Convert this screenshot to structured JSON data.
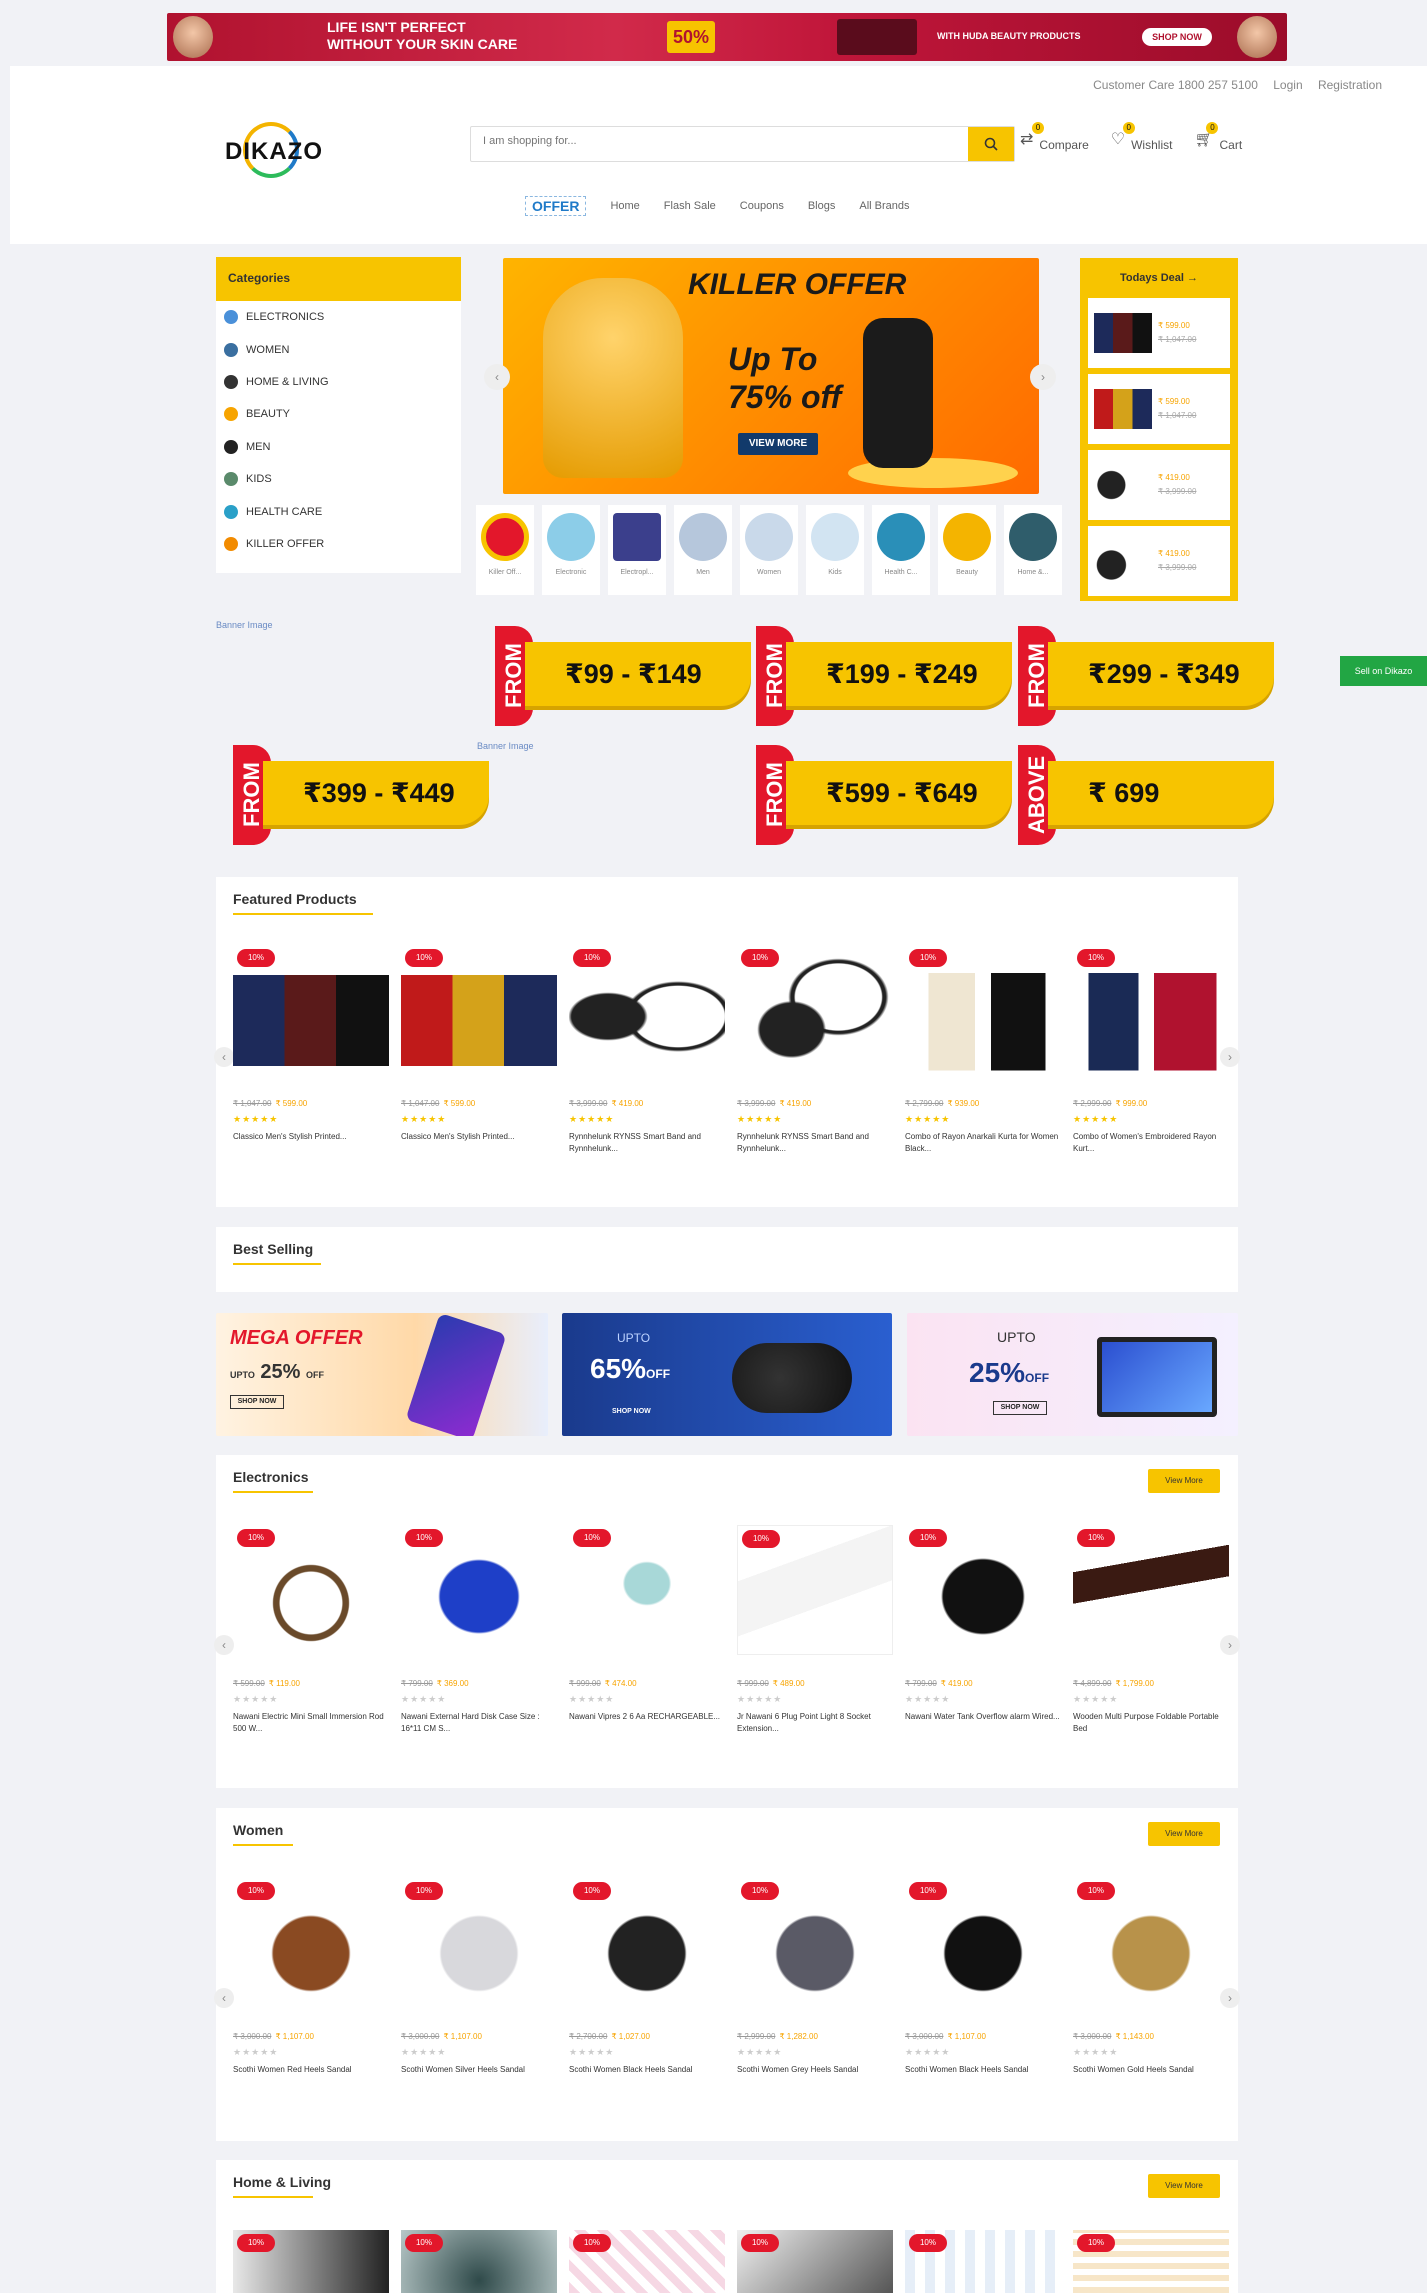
{
  "colors": {
    "accent": "#f7c400",
    "sale": "#e3172b",
    "green": "#22a644",
    "navy": "#123a6b"
  },
  "topbar": {
    "line1": "LIFE ISN'T PERFECT",
    "line2": "WITHOUT YOUR SKIN CARE",
    "badge": "50%",
    "promo": "WITH HUDA BEAUTY PRODUCTS",
    "shop": "SHOP NOW"
  },
  "util": {
    "care": "Customer Care 1800 257 5100",
    "login": "Login",
    "register": "Registration"
  },
  "logo": {
    "text": "DIKAZO"
  },
  "search": {
    "placeholder": "I am shopping for..."
  },
  "header_icons": {
    "compare": "Compare",
    "wishlist": "Wishlist",
    "cart": "Cart",
    "compare_count": "0",
    "wishlist_count": "0",
    "cart_count": "0"
  },
  "nav": {
    "offer": "OFFER",
    "items": [
      "Home",
      "Flash Sale",
      "Coupons",
      "Blogs",
      "All Brands"
    ]
  },
  "categories": {
    "title": "Categories",
    "items": [
      "ELECTRONICS",
      "WOMEN",
      "HOME & LIVING",
      "BEAUTY",
      "MEN",
      "KIDS",
      "HEALTH CARE",
      "KILLER OFFER"
    ]
  },
  "hero": {
    "title": "KILLER OFFER",
    "line1": "Up To",
    "line2": "75% off",
    "cta": "VIEW MORE"
  },
  "category_circles": [
    "Killer Off...",
    "Electronic",
    "Electropl...",
    "Men",
    "Women",
    "Kids",
    "Health C...",
    "Beauty",
    "Home &..."
  ],
  "todays_deal": {
    "title": "Todays Deal",
    "items": [
      {
        "price": "₹ 599.00",
        "old": "₹ 1,047.00"
      },
      {
        "price": "₹ 599.00",
        "old": "₹ 1,047.00"
      },
      {
        "price": "₹ 419.00",
        "old": "₹ 3,999.00"
      },
      {
        "price": "₹ 419.00",
        "old": "₹ 3,999.00"
      }
    ]
  },
  "price_tags": [
    {
      "label": "FROM",
      "range": "₹99 - ₹149"
    },
    {
      "label": "FROM",
      "range": "₹199 - ₹249"
    },
    {
      "label": "FROM",
      "range": "₹299 - ₹349"
    },
    {
      "label": "FROM",
      "range": "₹399 - ₹449"
    },
    {
      "label": "FROM",
      "range": "₹599 - ₹649"
    },
    {
      "label": "ABOVE",
      "range": "₹ 699"
    }
  ],
  "broken_images": [
    "Banner Image",
    "Banner Image"
  ],
  "green_button": "Sell on Dikazo",
  "featured": {
    "title": "Featured Products",
    "products": [
      {
        "old": "₹ 1,047.00",
        "price": "₹ 599.00",
        "name": "Classico Men's Stylish Printed..."
      },
      {
        "old": "₹ 1,047.00",
        "price": "₹ 599.00",
        "name": "Classico Men's Stylish Printed..."
      },
      {
        "old": "₹ 3,999.00",
        "price": "₹ 419.00",
        "name": "Rynnhelunk RYNSS Smart Band and Rynnhelunk..."
      },
      {
        "old": "₹ 3,999.00",
        "price": "₹ 419.00",
        "name": "Rynnhelunk RYNSS Smart Band and Rynnhelunk..."
      },
      {
        "old": "₹ 2,799.00",
        "price": "₹ 939.00",
        "name": "Combo of Rayon Anarkali Kurta for Women Black..."
      },
      {
        "old": "₹ 2,999.00",
        "price": "₹ 999.00",
        "name": "Combo of Women's Embroidered Rayon Kurt..."
      }
    ]
  },
  "best_selling": {
    "title": "Best Selling"
  },
  "banners": [
    {
      "title": "MEGA OFFER",
      "sub": "UPTO",
      "pct": "25%",
      "off": "OFF",
      "cta": "SHOP NOW"
    },
    {
      "sub": "UPTO",
      "pct": "65%",
      "off": "OFF",
      "cta": "SHOP NOW"
    },
    {
      "sub": "UPTO",
      "pct": "25%",
      "off": "OFF",
      "cta": "SHOP NOW"
    }
  ],
  "electronics": {
    "title": "Electronics",
    "more": "View More",
    "products": [
      {
        "old": "₹ 599.00",
        "price": "₹ 119.00",
        "name": "Nawani Electric Mini Small Immersion Rod 500 W..."
      },
      {
        "old": "₹ 799.00",
        "price": "₹ 369.00",
        "name": "Nawani External Hard Disk Case Size : 16*11 CM S..."
      },
      {
        "old": "₹ 999.00",
        "price": "₹ 474.00",
        "name": "Nawani Vipres 2 6 Aa RECHARGEABLE..."
      },
      {
        "old": "₹ 999.00",
        "price": "₹ 489.00",
        "name": "Jr Nawani 6 Plug Point Light 8 Socket Extension..."
      },
      {
        "old": "₹ 799.00",
        "price": "₹ 419.00",
        "name": "Nawani Water Tank Overflow alarm Wired..."
      },
      {
        "old": "₹ 4,899.00",
        "price": "₹ 1,799.00",
        "name": "Wooden Multi Purpose Foldable Portable Bed"
      }
    ]
  },
  "women": {
    "title": "Women",
    "more": "View More",
    "products": [
      {
        "old": "₹ 3,000.00",
        "price": "₹ 1,107.00",
        "name": "Scothi Women Red Heels Sandal"
      },
      {
        "old": "₹ 3,000.00",
        "price": "₹ 1,107.00",
        "name": "Scothi Women Silver Heels Sandal"
      },
      {
        "old": "₹ 2,700.00",
        "price": "₹ 1,027.00",
        "name": "Scothi Women Black Heels Sandal"
      },
      {
        "old": "₹ 2,999.00",
        "price": "₹ 1,282.00",
        "name": "Scothi Women Grey Heels Sandal"
      },
      {
        "old": "₹ 3,000.00",
        "price": "₹ 1,107.00",
        "name": "Scothi Women Black Heels Sandal"
      },
      {
        "old": "₹ 3,000.00",
        "price": "₹ 1,143.00",
        "name": "Scothi Women Gold Heels Sandal"
      }
    ]
  },
  "home_living": {
    "title": "Home & Living",
    "more": "View More"
  },
  "discount_badge": "10%",
  "stars": "★★★★★"
}
